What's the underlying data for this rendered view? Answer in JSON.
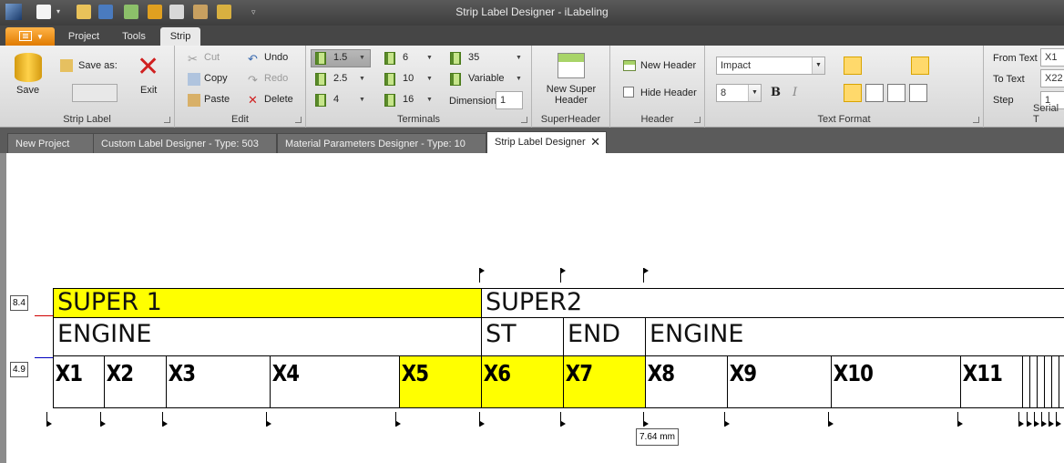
{
  "window": {
    "title": "Strip Label Designer - iLabeling"
  },
  "ribbon_tabs": [
    "Project",
    "Tools",
    "Strip"
  ],
  "active_tab": "Strip",
  "ribbon": {
    "strip_label": {
      "save": "Save",
      "save_as": "Save as:",
      "exit": "Exit",
      "label": "Strip Label"
    },
    "edit": {
      "cut": "Cut",
      "copy": "Copy",
      "paste": "Paste",
      "undo": "Undo",
      "redo": "Redo",
      "delete": "Delete",
      "label": "Edit"
    },
    "terminals": {
      "col1": [
        "1.5",
        "2.5",
        "4"
      ],
      "col2": [
        "6",
        "10",
        "16"
      ],
      "col3": [
        "35",
        "Variable"
      ],
      "dimension_label": "Dimension",
      "dimension_value": "1",
      "label": "Terminals"
    },
    "superheader": {
      "button": [
        "New Super",
        "Header"
      ],
      "label": "SuperHeader"
    },
    "header": {
      "new_header": "New Header",
      "hide_header": "Hide Header",
      "label": "Header"
    },
    "text_format": {
      "font": "Impact",
      "size": "8",
      "bold": "B",
      "italic": "I",
      "label": "Text Format"
    },
    "serial": {
      "from_label": "From Text",
      "from_value": "X1",
      "to_label": "To Text",
      "to_value": "X22",
      "step_label": "Step",
      "step_value": "1",
      "label": "Serial T"
    }
  },
  "doc_tabs": [
    "New Project",
    "Custom Label Designer - Type: 503",
    "Material Parameters Designer - Type: 10",
    "Strip Label Designer"
  ],
  "canvas": {
    "ruler_top": "8.4",
    "ruler_bottom": "4.9",
    "measure": "7.64 mm",
    "super_headers": [
      "SUPER 1",
      "SUPER2"
    ],
    "headers": [
      "ENGINE",
      "ST",
      "END",
      "ENGINE"
    ],
    "terminals": [
      "X1",
      "X2",
      "X3",
      "X4",
      "X5",
      "X6",
      "X7",
      "X8",
      "X9",
      "X10",
      "X11"
    ],
    "highlight_color": "#ffff00"
  }
}
